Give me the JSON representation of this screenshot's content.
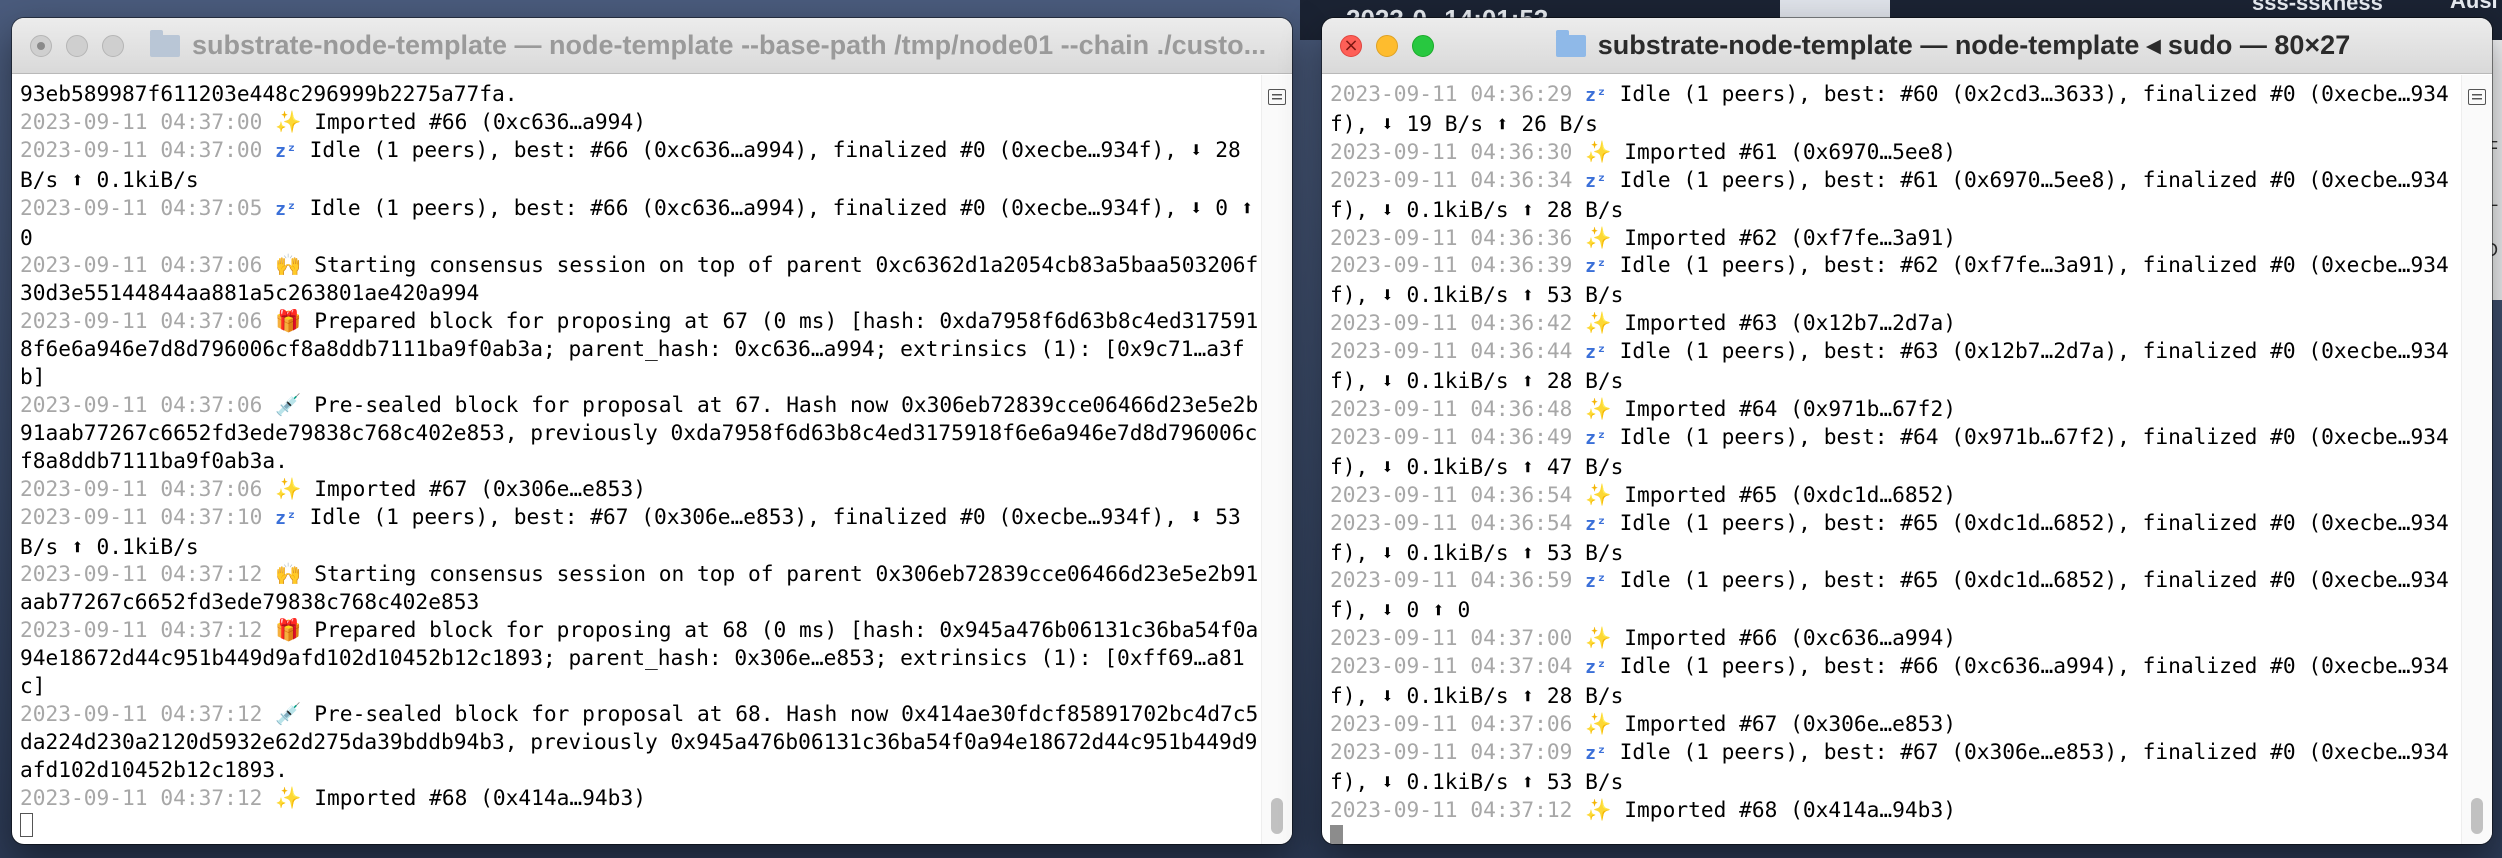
{
  "desktop": {
    "top_text": "2023-0--14:01:53",
    "corner_text_1": "sss-sskness",
    "corner_text_2": "Ausi",
    "side_letters": [
      "F",
      "L",
      "D"
    ]
  },
  "left_window": {
    "title": "substrate-node-template — node-template --base-path /tmp/node01 --chain ./custo...",
    "lines": [
      {
        "ts": "",
        "icon": "",
        "text": "93eb589987f611203e448c296999b2275a77fa."
      },
      {
        "ts": "2023-09-11 04:37:00",
        "icon": "sparkle",
        "text": "Imported #66 (0xc636…a994)"
      },
      {
        "ts": "2023-09-11 04:37:00",
        "icon": "sleep",
        "text": "Idle (1 peers), best: #66 (0xc636…a994), finalized #0 (0xecbe…934f), ⬇ 28 B/s ⬆ 0.1kiB/s"
      },
      {
        "ts": "2023-09-11 04:37:05",
        "icon": "sleep",
        "text": "Idle (1 peers), best: #66 (0xc636…a994), finalized #0 (0xecbe…934f), ⬇ 0 ⬆ 0"
      },
      {
        "ts": "2023-09-11 04:37:06",
        "icon": "hands",
        "text": "Starting consensus session on top of parent 0xc6362d1a2054cb83a5baa503206f30d3e55144844aa881a5c263801ae420a994"
      },
      {
        "ts": "2023-09-11 04:37:06",
        "icon": "gift",
        "text": "Prepared block for proposing at 67 (0 ms) [hash: 0xda7958f6d63b8c4ed3175918f6e6a946e7d8d796006cf8a8ddb7111ba9f0ab3a; parent_hash: 0xc636…a994; extrinsics (1): [0x9c71…a3fb]"
      },
      {
        "ts": "2023-09-11 04:37:06",
        "icon": "needle",
        "text": "Pre-sealed block for proposal at 67. Hash now 0x306eb72839cce06466d23e5e2b91aab77267c6652fd3ede79838c768c402e853, previously 0xda7958f6d63b8c4ed3175918f6e6a946e7d8d796006cf8a8ddb7111ba9f0ab3a."
      },
      {
        "ts": "2023-09-11 04:37:06",
        "icon": "sparkle",
        "text": "Imported #67 (0x306e…e853)"
      },
      {
        "ts": "2023-09-11 04:37:10",
        "icon": "sleep",
        "text": "Idle (1 peers), best: #67 (0x306e…e853), finalized #0 (0xecbe…934f), ⬇ 53 B/s ⬆ 0.1kiB/s"
      },
      {
        "ts": "2023-09-11 04:37:12",
        "icon": "hands",
        "text": "Starting consensus session on top of parent 0x306eb72839cce06466d23e5e2b91aab77267c6652fd3ede79838c768c402e853"
      },
      {
        "ts": "2023-09-11 04:37:12",
        "icon": "gift",
        "text": "Prepared block for proposing at 68 (0 ms) [hash: 0x945a476b06131c36ba54f0a94e18672d44c951b449d9afd102d10452b12c1893; parent_hash: 0x306e…e853; extrinsics (1): [0xff69…a81c]"
      },
      {
        "ts": "2023-09-11 04:37:12",
        "icon": "needle",
        "text": "Pre-sealed block for proposal at 68. Hash now 0x414ae30fdcf85891702bc4d7c5da224d230a2120d5932e62d275da39bddb94b3, previously 0x945a476b06131c36ba54f0a94e18672d44c951b449d9afd102d10452b12c1893."
      },
      {
        "ts": "2023-09-11 04:37:12",
        "icon": "sparkle",
        "text": "Imported #68 (0x414a…94b3)"
      }
    ]
  },
  "right_window": {
    "title": "substrate-node-template — node-template ◂ sudo — 80×27",
    "lines": [
      {
        "ts": "2023-09-11 04:36:29",
        "icon": "sleep",
        "text": "Idle (1 peers), best: #60 (0x2cd3…3633), finalized #0 (0xecbe…934f), ⬇ 19 B/s ⬆ 26 B/s"
      },
      {
        "ts": "2023-09-11 04:36:30",
        "icon": "sparkle",
        "text": "Imported #61 (0x6970…5ee8)"
      },
      {
        "ts": "2023-09-11 04:36:34",
        "icon": "sleep",
        "text": "Idle (1 peers), best: #61 (0x6970…5ee8), finalized #0 (0xecbe…934f), ⬇ 0.1kiB/s ⬆ 28 B/s"
      },
      {
        "ts": "2023-09-11 04:36:36",
        "icon": "sparkle",
        "text": "Imported #62 (0xf7fe…3a91)"
      },
      {
        "ts": "2023-09-11 04:36:39",
        "icon": "sleep",
        "text": "Idle (1 peers), best: #62 (0xf7fe…3a91), finalized #0 (0xecbe…934f), ⬇ 0.1kiB/s ⬆ 53 B/s"
      },
      {
        "ts": "2023-09-11 04:36:42",
        "icon": "sparkle",
        "text": "Imported #63 (0x12b7…2d7a)"
      },
      {
        "ts": "2023-09-11 04:36:44",
        "icon": "sleep",
        "text": "Idle (1 peers), best: #63 (0x12b7…2d7a), finalized #0 (0xecbe…934f), ⬇ 0.1kiB/s ⬆ 28 B/s"
      },
      {
        "ts": "2023-09-11 04:36:48",
        "icon": "sparkle",
        "text": "Imported #64 (0x971b…67f2)"
      },
      {
        "ts": "2023-09-11 04:36:49",
        "icon": "sleep",
        "text": "Idle (1 peers), best: #64 (0x971b…67f2), finalized #0 (0xecbe…934f), ⬇ 0.1kiB/s ⬆ 47 B/s"
      },
      {
        "ts": "2023-09-11 04:36:54",
        "icon": "sparkle",
        "text": "Imported #65 (0xdc1d…6852)"
      },
      {
        "ts": "2023-09-11 04:36:54",
        "icon": "sleep",
        "text": "Idle (1 peers), best: #65 (0xdc1d…6852), finalized #0 (0xecbe…934f), ⬇ 0.1kiB/s ⬆ 53 B/s"
      },
      {
        "ts": "2023-09-11 04:36:59",
        "icon": "sleep",
        "text": "Idle (1 peers), best: #65 (0xdc1d…6852), finalized #0 (0xecbe…934f), ⬇ 0 ⬆ 0"
      },
      {
        "ts": "2023-09-11 04:37:00",
        "icon": "sparkle",
        "text": "Imported #66 (0xc636…a994)"
      },
      {
        "ts": "2023-09-11 04:37:04",
        "icon": "sleep",
        "text": "Idle (1 peers), best: #66 (0xc636…a994), finalized #0 (0xecbe…934f), ⬇ 0.1kiB/s ⬆ 28 B/s"
      },
      {
        "ts": "2023-09-11 04:37:06",
        "icon": "sparkle",
        "text": "Imported #67 (0x306e…e853)"
      },
      {
        "ts": "2023-09-11 04:37:09",
        "icon": "sleep",
        "text": "Idle (1 peers), best: #67 (0x306e…e853), finalized #0 (0xecbe…934f), ⬇ 0.1kiB/s ⬆ 53 B/s"
      },
      {
        "ts": "2023-09-11 04:37:12",
        "icon": "sparkle",
        "text": "Imported #68 (0x414a…94b3)"
      }
    ]
  },
  "icons": {
    "sleep": {
      "name": "sleep-zzz-icon",
      "glyph": "zᶻ"
    },
    "sparkle": {
      "name": "sparkles-icon",
      "glyph": "✨"
    },
    "hands": {
      "name": "raised-hands-icon",
      "glyph": "🙌"
    },
    "gift": {
      "name": "gift-icon",
      "glyph": "🎁"
    },
    "needle": {
      "name": "syringe-icon",
      "glyph": "💉"
    }
  }
}
